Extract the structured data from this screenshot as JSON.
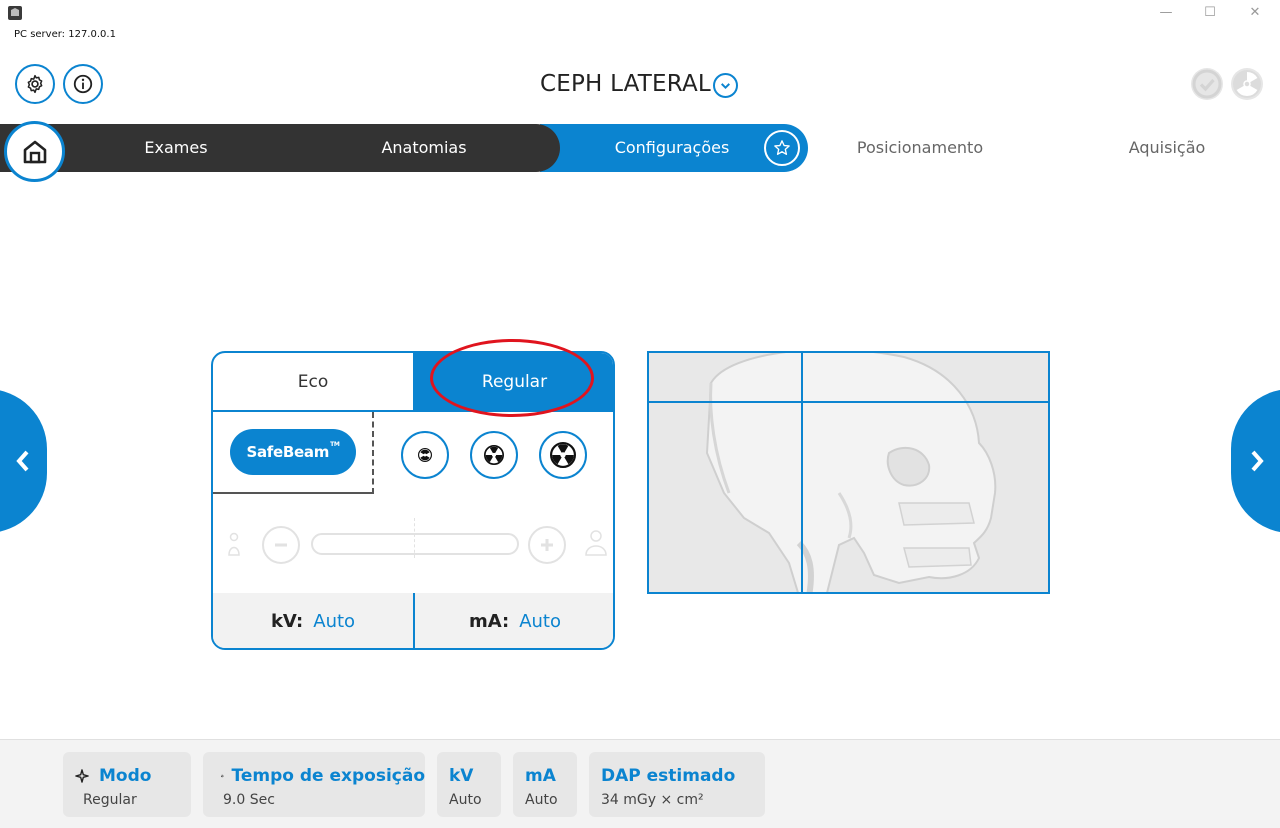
{
  "window": {
    "server_label": "PC server: 127.0.0.1",
    "controls": {
      "minimize": "—",
      "maximize": "☐",
      "close": "✕"
    }
  },
  "header": {
    "title": "CEPH LATERAL",
    "settings_icon": "gear-icon",
    "info_icon": "info-icon",
    "status_icons": [
      "check-circle-icon",
      "radiation-icon"
    ]
  },
  "nav": {
    "steps": [
      {
        "label": "Exames",
        "state": "done"
      },
      {
        "label": "Anatomias",
        "state": "done"
      },
      {
        "label": "Configurações",
        "state": "active"
      },
      {
        "label": "Posicionamento",
        "state": "pending"
      },
      {
        "label": "Aquisição",
        "state": "pending"
      }
    ]
  },
  "panel": {
    "tabs": [
      {
        "label": "Eco",
        "selected": false
      },
      {
        "label": "Regular",
        "selected": true
      }
    ],
    "safebeam_label": "SafeBeam",
    "safebeam_tm": "TM",
    "dose_levels": [
      "low",
      "medium",
      "high"
    ],
    "kv_label": "kV:",
    "kv_value": "Auto",
    "ma_label": "mA:",
    "ma_value": "Auto"
  },
  "footer": {
    "modo_title": "Modo",
    "modo_value": "Regular",
    "tempo_title": "Tempo de exposição",
    "tempo_value": "9.0 Sec",
    "kv_title": "kV",
    "kv_value": "Auto",
    "ma_title": "mA",
    "ma_value": "Auto",
    "dap_title": "DAP estimado",
    "dap_value": "34 mGy × cm²"
  },
  "colors": {
    "accent": "#0b84d0",
    "dark_nav": "#333333",
    "annotation": "#e0141e"
  }
}
